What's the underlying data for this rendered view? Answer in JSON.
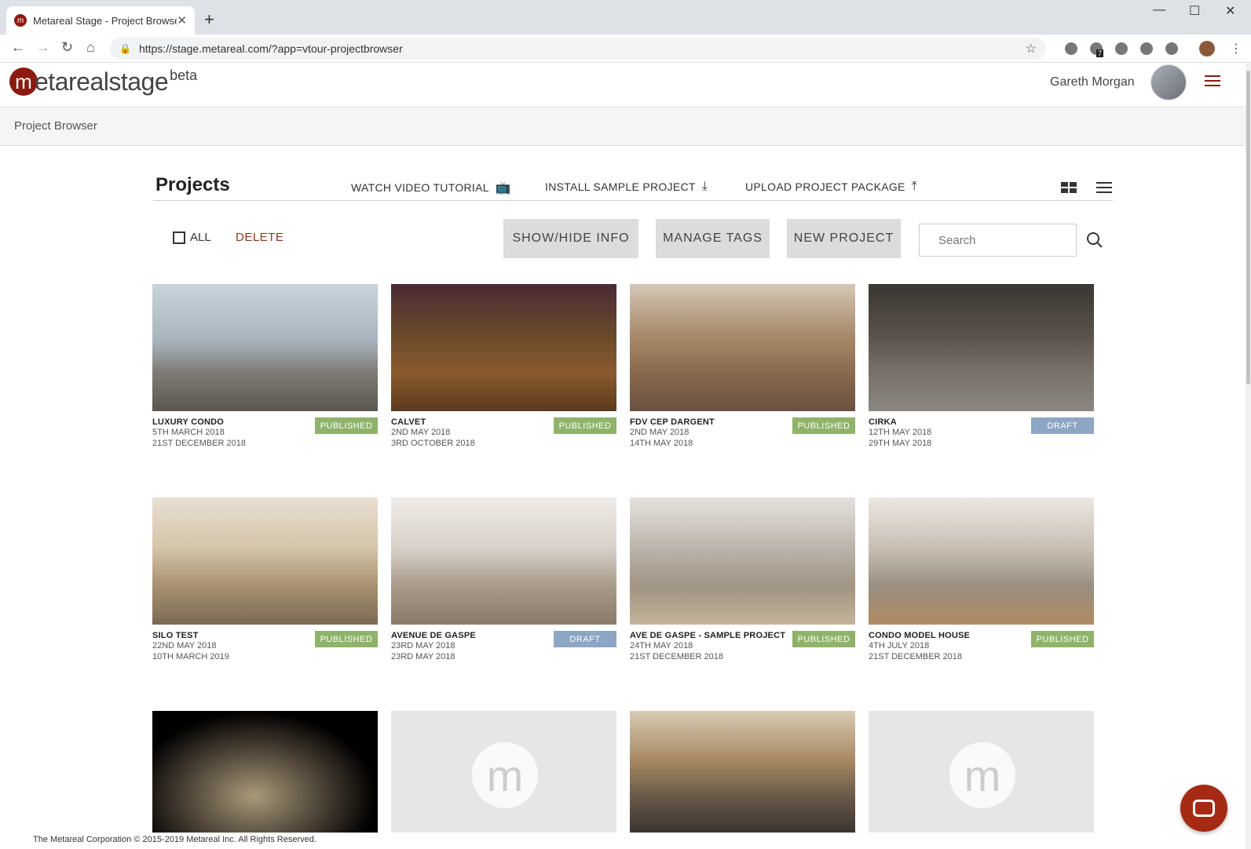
{
  "browser": {
    "tab_title": "Metareal Stage - Project Browser",
    "url": "https://stage.metareal.com/?app=vtour-projectbrowser",
    "extension_badge": "7"
  },
  "header": {
    "logo_text": "etarealstage",
    "logo_beta": "beta",
    "user_name": "Gareth Morgan"
  },
  "breadcrumb": "Project Browser",
  "toolbar": {
    "title": "Projects",
    "watch_tutorial": "WATCH VIDEO TUTORIAL",
    "install_sample": "INSTALL SAMPLE PROJECT",
    "upload_package": "UPLOAD PROJECT PACKAGE",
    "select_all": "ALL",
    "delete": "DELETE",
    "show_hide": "SHOW/HIDE INFO",
    "manage_tags": "MANAGE TAGS",
    "new_project": "NEW PROJECT",
    "search_placeholder": "Search"
  },
  "colors": {
    "published": "#8fb36a",
    "draft": "#8ca6c4",
    "brand": "#8b1a10"
  },
  "projects": [
    {
      "name": "LUXURY CONDO",
      "created": "5TH MARCH 2018",
      "modified": "21ST DECEMBER 2018",
      "status": "PUBLISHED"
    },
    {
      "name": "CALVET",
      "created": "2ND MAY 2018",
      "modified": "3RD OCTOBER 2018",
      "status": "PUBLISHED"
    },
    {
      "name": "FDV CEP DARGENT",
      "created": "2ND MAY 2018",
      "modified": "14TH MAY 2018",
      "status": "PUBLISHED"
    },
    {
      "name": "CIRKA",
      "created": "12TH MAY 2018",
      "modified": "29TH MAY 2018",
      "status": "DRAFT"
    },
    {
      "name": "SILO TEST",
      "created": "22ND MAY 2018",
      "modified": "10TH MARCH 2019",
      "status": "PUBLISHED"
    },
    {
      "name": "AVENUE DE GASPE",
      "created": "23RD MAY 2018",
      "modified": "23RD MAY 2018",
      "status": "DRAFT"
    },
    {
      "name": "AVE DE GASPE - SAMPLE PROJECT",
      "created": "24TH MAY 2018",
      "modified": "21ST DECEMBER 2018",
      "status": "PUBLISHED"
    },
    {
      "name": "CONDO MODEL HOUSE",
      "created": "4TH JULY 2018",
      "modified": "21ST DECEMBER 2018",
      "status": "PUBLISHED"
    }
  ],
  "placeholder_logo": "m",
  "footer": "The Metareal Corporation © 2015-2019 Metareal Inc. All Rights Reserved."
}
